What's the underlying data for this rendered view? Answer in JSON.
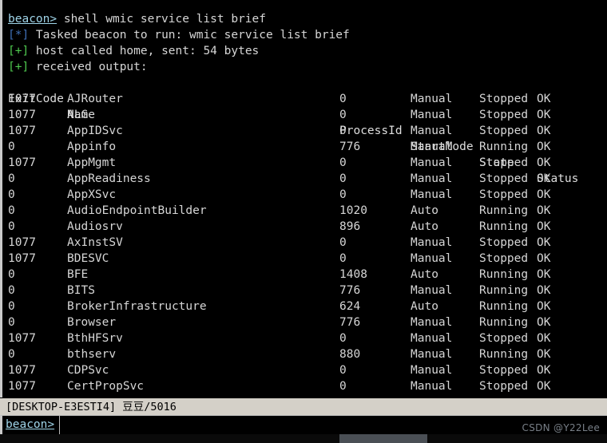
{
  "console": {
    "command_line": {
      "prompt": "beacon>",
      "command": " shell wmic service list brief"
    },
    "messages": [
      {
        "tag": "[*]",
        "tag_type": "star",
        "text": " Tasked beacon to run: wmic service list brief"
      },
      {
        "tag": "[+]",
        "tag_type": "plus",
        "text": " host called home, sent: 54 bytes"
      },
      {
        "tag": "[+]",
        "tag_type": "plus",
        "text": " received output:"
      }
    ],
    "table": {
      "headers": [
        "ExitCode",
        "Name",
        "ProcessId",
        "StartMode",
        "State",
        "Status"
      ],
      "rows": [
        [
          "1077",
          "AJRouter",
          "0",
          "Manual",
          "Stopped",
          "OK"
        ],
        [
          "1077",
          "ALG",
          "0",
          "Manual",
          "Stopped",
          "OK"
        ],
        [
          "1077",
          "AppIDSvc",
          "0",
          "Manual",
          "Stopped",
          "OK"
        ],
        [
          "0",
          "Appinfo",
          "776",
          "Manual",
          "Running",
          "OK"
        ],
        [
          "1077",
          "AppMgmt",
          "0",
          "Manual",
          "Stopped",
          "OK"
        ],
        [
          "0",
          "AppReadiness",
          "0",
          "Manual",
          "Stopped",
          "OK"
        ],
        [
          "0",
          "AppXSvc",
          "0",
          "Manual",
          "Stopped",
          "OK"
        ],
        [
          "0",
          "AudioEndpointBuilder",
          "1020",
          "Auto",
          "Running",
          "OK"
        ],
        [
          "0",
          "Audiosrv",
          "896",
          "Auto",
          "Running",
          "OK"
        ],
        [
          "1077",
          "AxInstSV",
          "0",
          "Manual",
          "Stopped",
          "OK"
        ],
        [
          "1077",
          "BDESVC",
          "0",
          "Manual",
          "Stopped",
          "OK"
        ],
        [
          "0",
          "BFE",
          "1408",
          "Auto",
          "Running",
          "OK"
        ],
        [
          "0",
          "BITS",
          "776",
          "Manual",
          "Running",
          "OK"
        ],
        [
          "0",
          "BrokerInfrastructure",
          "624",
          "Auto",
          "Running",
          "OK"
        ],
        [
          "0",
          "Browser",
          "776",
          "Manual",
          "Running",
          "OK"
        ],
        [
          "1077",
          "BthHFSrv",
          "0",
          "Manual",
          "Stopped",
          "OK"
        ],
        [
          "0",
          "bthserv",
          "880",
          "Manual",
          "Running",
          "OK"
        ],
        [
          "1077",
          "CDPSvc",
          "0",
          "Manual",
          "Stopped",
          "OK"
        ],
        [
          "1077",
          "CertPropSvc",
          "0",
          "Manual",
          "Stopped",
          "OK"
        ]
      ]
    }
  },
  "statusbar": {
    "text": "[DESKTOP-E3ESTI4] 豆豆/5016"
  },
  "input": {
    "prompt_label": "beacon>",
    "value": "",
    "placeholder": ""
  },
  "watermark": {
    "text": "CSDN @Y22Lee"
  },
  "colors": {
    "background": "#000000",
    "text": "#d6d6d6",
    "prompt": "#9fd4e8",
    "tag_star": "#3f6fb5",
    "tag_plus": "#4fc94f",
    "statusbar_bg": "#d4d0c8",
    "border": "#c9c9c9",
    "scrollbar_thumb": "#4a4f55"
  }
}
